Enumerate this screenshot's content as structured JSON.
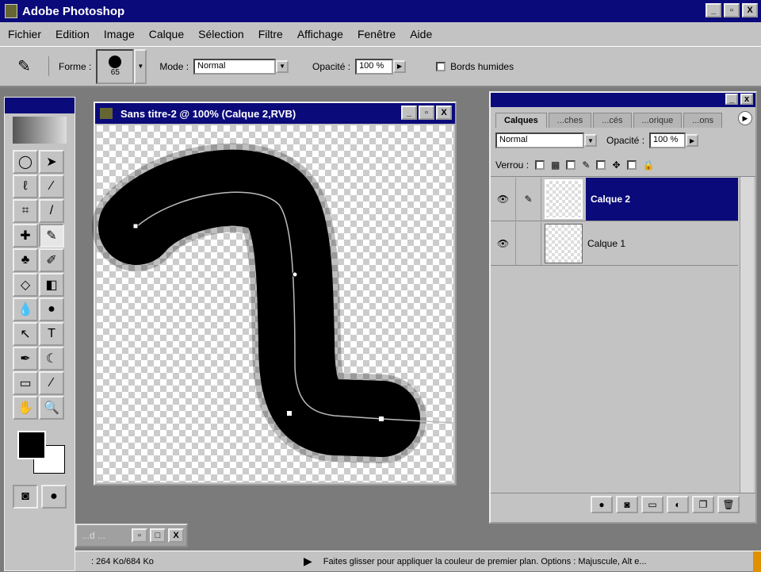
{
  "app": {
    "title": "Adobe Photoshop",
    "window_buttons": [
      "_",
      "▫",
      "X"
    ]
  },
  "menu": [
    "Fichier",
    "Edition",
    "Image",
    "Calque",
    "Sélection",
    "Filtre",
    "Affichage",
    "Fenêtre",
    "Aide"
  ],
  "options": {
    "forme_label": "Forme :",
    "brush_size": "65",
    "mode_label": "Mode :",
    "mode_value": "Normal",
    "opacity_label": "Opacité :",
    "opacity_value": "100 %",
    "wet_edges_label": "Bords humides"
  },
  "document": {
    "title": "Sans titre-2 @ 100% (Calque  2,RVB)"
  },
  "layers_panel": {
    "tabs": [
      "Calques",
      "...ches",
      "...cés",
      "...orique",
      "...ons"
    ],
    "blend_mode": "Normal",
    "opacity_label": "Opacité :",
    "opacity_value": "100 %",
    "lock_label": "Verrou :",
    "layers": [
      {
        "name": "Calque  2",
        "selected": true
      },
      {
        "name": "Calque  1",
        "selected": false
      }
    ]
  },
  "minimized": {
    "label": "...d ..."
  },
  "status": {
    "doc_size": ": 264 Ko/684 Ko",
    "hint": "Faites glisser pour appliquer la couleur de premier plan. Options : Majuscule, Alt e..."
  },
  "colors": {
    "titlebar": "#0a0a7a",
    "chrome": "#c3c3c3",
    "selection": "#0a0a7a"
  }
}
